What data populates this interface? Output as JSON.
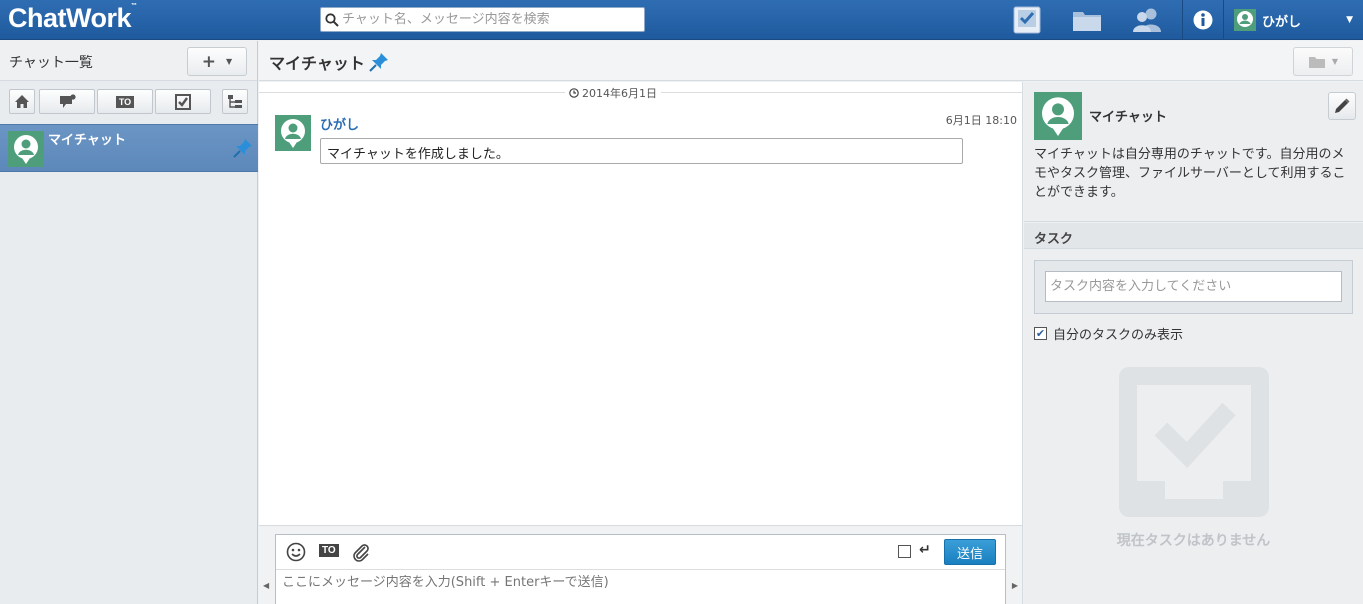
{
  "header": {
    "logo": "ChatWork",
    "logo_tm": "™",
    "search_placeholder": "チャット名、メッセージ内容を検索",
    "user_name": "ひがし",
    "caret": "▼"
  },
  "sidebar": {
    "title": "チャット一覧",
    "add_label": "+",
    "caret": "▼",
    "filters": [
      "home-icon",
      "unread-icon",
      "to-icon",
      "task-icon",
      "tree-icon"
    ],
    "to_label": "TO",
    "chats": [
      {
        "name": "マイチャット",
        "pinned": true,
        "selected": true
      }
    ]
  },
  "room": {
    "title": "マイチャット",
    "folder_caret": "▼"
  },
  "timeline": {
    "date": "2014年6月1日",
    "messages": [
      {
        "user": "ひがし",
        "time": "6月1日 18:10",
        "body": "マイチャットを作成しました。"
      }
    ]
  },
  "composer": {
    "to_label": "TO",
    "enter_symbol": "↵",
    "send_label": "送信",
    "placeholder": "ここにメッセージ内容を入力(Shift + Enterキーで送信)",
    "arrow_left": "◀",
    "arrow_right": "▶"
  },
  "info": {
    "name": "マイチャット",
    "description": "マイチャットは自分専用のチャットです。自分用のメモやタスク管理、ファイルサーバーとして利用することができます。"
  },
  "tasks": {
    "title": "タスク",
    "input_placeholder": "タスク内容を入力してください",
    "mine_only_label": "自分のタスクのみ表示",
    "mine_only_checked": true,
    "check_mark": "✔",
    "empty_text": "現在タスクはありません"
  },
  "colors": {
    "header_bg": "#2f6db2",
    "selected_chat_bg": "#6b95c4",
    "avatar_green": "#4e9e7c",
    "send_button": "#2a8fcf",
    "user_link": "#2a6db5"
  }
}
